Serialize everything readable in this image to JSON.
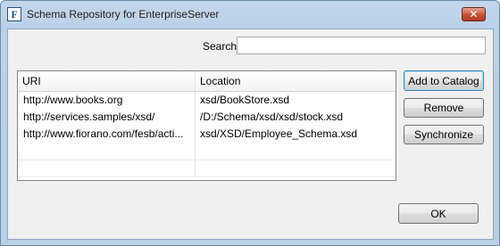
{
  "window": {
    "title": "Schema Repository for EnterpriseServer",
    "app_icon_glyph": "F"
  },
  "search": {
    "label": "Search:",
    "value": "",
    "placeholder": ""
  },
  "table": {
    "columns": [
      "URI",
      "Location"
    ],
    "rows": [
      {
        "uri": "http://www.books.org",
        "location": "xsd/BookStore.xsd"
      },
      {
        "uri": "http://services.samples/xsd/",
        "location": "/D:/Schema/xsd/xsd/stock.xsd"
      },
      {
        "uri": "http://www.fiorano.com/fesb/acti...",
        "location": "xsd/XSD/Employee_Schema.xsd"
      }
    ]
  },
  "buttons": {
    "add": "Add to Catalog",
    "remove": "Remove",
    "synchronize": "Synchronize",
    "ok": "OK"
  },
  "colors": {
    "title_bar": "#bcd1e7",
    "close_button": "#c7513a",
    "dialog_body": "#f0f0f0"
  }
}
